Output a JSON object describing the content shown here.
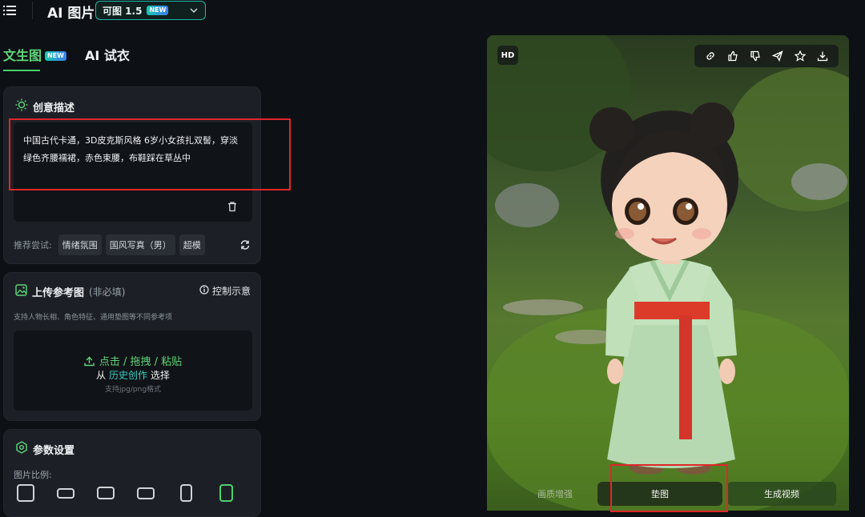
{
  "header": {
    "title": "AI 图片",
    "model": {
      "name": "可图 1.5",
      "badge": "NEW"
    }
  },
  "tabs": [
    {
      "label": "文生图",
      "badge": "NEW",
      "active": true
    },
    {
      "label": "AI 试衣",
      "active": false
    }
  ],
  "creative": {
    "title": "创意描述",
    "prompt": "中国古代卡通，3D皮克斯风格  6岁小女孩扎双髻，穿淡绿色齐腰襦裙，赤色束腰，布鞋踩在草丛中",
    "suggest_label": "推荐尝试:",
    "suggestions": [
      "情绪氛围",
      "国风写真（男）",
      "超模"
    ]
  },
  "upload": {
    "title": "上传参考图",
    "optional": "(非必填)",
    "control_link": "控制示意",
    "hint": "支持人物长相、角色特征、通用垫图等不同参考项",
    "drop_primary": "点击 / 拖拽 / 粘贴",
    "drop_from": "从",
    "drop_history": "历史创作",
    "drop_select": "选择",
    "drop_formats": "支持jpg/png格式"
  },
  "params": {
    "title": "参数设置",
    "ratio_label": "图片比例:",
    "selected_ratio_index": 5
  },
  "image": {
    "hd_label": "HD",
    "actions": [
      "link-icon",
      "thumbs-up-icon",
      "thumbs-down-icon",
      "share-icon",
      "star-icon",
      "download-icon"
    ],
    "bottom_buttons": [
      "画质增强",
      "垫图",
      "生成视频"
    ]
  },
  "colors": {
    "accent_green": "#5fd67a",
    "accent_teal": "#35d0c0",
    "highlight_red": "#e0262a",
    "background": "#0d1014"
  }
}
